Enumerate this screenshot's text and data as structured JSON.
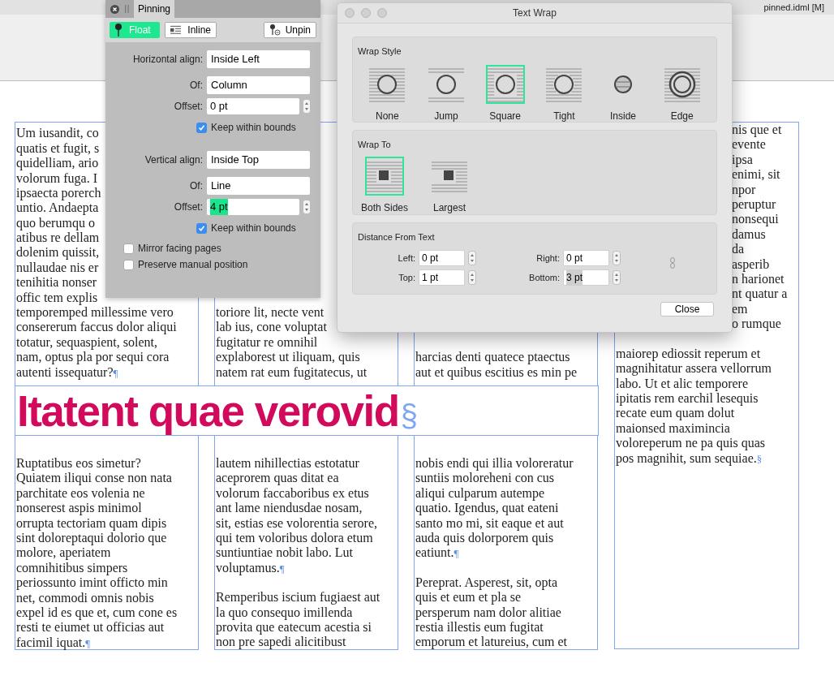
{
  "app": {
    "document_title": "pinned.idml [M]"
  },
  "document": {
    "top_columns": [
      {
        "lines": [
          "Um iusandit, co",
          "quatis et fugit, s",
          "quidelliam, ario",
          "volorum fuga. I",
          "ipsaecta porerch",
          "untio. Andaepta",
          "quo berumqu o",
          "atibus re dellam",
          "dolenim quissit,",
          "nullaudae nis er",
          "tenihitia nonser",
          "offic tem explis",
          "temporemped millessime vero",
          "consererum faccus dolor aliqui",
          "totatur, sequaspient, solent,",
          "nam, optus pla por sequi cora",
          "autenti issequatur?"
        ],
        "end_mark": "¶"
      },
      {
        "lines": [
          "toriore lit, necte vent",
          "lab ius, cone voluptat",
          "fugitatur re omnihil",
          "explaborest ut iliquam, quis",
          "natem rat eum fugitatecus, ut"
        ]
      },
      {
        "lines": [
          "harcias denti quatece ptaectus",
          "aut et quibus escitius es min pe"
        ]
      }
    ],
    "headline": {
      "text": "Itatent quae verovid",
      "end_mark": "§"
    },
    "bottom_columns": [
      {
        "paragraphs": [
          {
            "lines": [
              "Ruptatibus eos simetur?",
              "Quiatem iliqui conse non nata",
              "parchitate eos volenia ne",
              "nonserest aspis minimol",
              "orrupta tectoriam quam dipis",
              "sint doloreptaqui dolorio que",
              "molore, aperiatem",
              "comnihitibus simpers",
              "periossunto imint officto min",
              "net, commodi omnis nobis",
              "expel id es que et, cum cone es",
              "resti te eiumet ut officias aut",
              "facimil iquat."
            ],
            "end_mark": "¶"
          }
        ]
      },
      {
        "paragraphs": [
          {
            "lines": [
              "lautem nihillectias estotatur",
              "aceprorem quas ditat ea",
              "volorum faccaboribus ex etus",
              "ant lame niendusdae nosam,",
              "sit, estias ese volorentia serore,",
              "qui tem voloribus dolora etum",
              "suntiuntiae nobit labo. Lut",
              "voluptamus."
            ],
            "end_mark": "¶"
          },
          {
            "lines": [
              "Remperibus iscium fugiaest aut",
              "la quo consequo imillenda",
              "provita que eatecum acestia si",
              "non pre sapedi alicitibust"
            ]
          }
        ]
      },
      {
        "paragraphs": [
          {
            "lines": [
              "nobis endi qui illia voloreratur",
              "suntiis moloreheni con cus",
              "aliqui culparum autempe",
              "quatio. Igendus, quat eateni",
              "santo mo mi, sit eaque et aut",
              "auda quis dolorporem quis",
              "eatiunt."
            ],
            "end_mark": "¶"
          },
          {
            "lines": [
              "Pereprat. Asperest, sit, opta",
              "quis et eum et pla se",
              "persperum nam dolor alitiae",
              "restia illestis eum fugitat",
              "emporum et latureius, cum et"
            ]
          }
        ]
      }
    ],
    "right_column": {
      "fragments": [
        "nis que et",
        "evente",
        "ipsa",
        "enimi, sit",
        "npor",
        "peruptur",
        "nonsequi",
        "damus",
        "da",
        "asperib",
        "n harionet",
        "nt quatur a",
        "em",
        "o rumque"
      ],
      "lines": [
        "maiorep ediossit reperum et",
        "magnihitatur assera vellorrum",
        "labo. Ut et alic temporere",
        "ipitatis rem earchil lesequis",
        "recate eum quam dolut",
        "maionsed maximincia",
        "voloreperum ne pa quis quas",
        "pos magnihit, sum sequiae."
      ],
      "end_mark": "§"
    }
  },
  "pinning_panel": {
    "tab": "Pinning",
    "modes": [
      {
        "kind": "float",
        "label": "Float",
        "selected": true
      },
      {
        "kind": "inline",
        "label": "Inline",
        "selected": false
      }
    ],
    "unpin_button": "Unpin",
    "groups": [
      {
        "align": {
          "label": "Horizontal align:",
          "value": "Inside Left"
        },
        "of": {
          "label": "Of:",
          "value": "Column"
        },
        "offset": {
          "label": "Offset:",
          "value": "0 pt",
          "text_selected": false
        },
        "keep": {
          "label": "Keep within bounds",
          "checked": true
        }
      },
      {
        "align": {
          "label": "Vertical align:",
          "value": "Inside Top"
        },
        "of": {
          "label": "Of:",
          "value": "Line"
        },
        "offset": {
          "label": "Offset:",
          "value": "4 pt",
          "text_selected": true
        },
        "keep": {
          "label": "Keep within bounds",
          "checked": true
        }
      }
    ],
    "options": [
      {
        "label": "Mirror facing pages",
        "checked": false
      },
      {
        "label": "Preserve manual position",
        "checked": false
      }
    ]
  },
  "text_wrap_dialog": {
    "title": "Text Wrap",
    "wrap_style": {
      "heading": "Wrap Style",
      "options": [
        {
          "kind": "none",
          "label": "None",
          "selected": false
        },
        {
          "kind": "jump",
          "label": "Jump",
          "selected": false
        },
        {
          "kind": "square",
          "label": "Square",
          "selected": true
        },
        {
          "kind": "tight",
          "label": "Tight",
          "selected": false
        },
        {
          "kind": "inside",
          "label": "Inside",
          "selected": false
        },
        {
          "kind": "edge",
          "label": "Edge",
          "selected": false
        }
      ]
    },
    "wrap_to": {
      "heading": "Wrap To",
      "options": [
        {
          "kind": "both",
          "label": "Both Sides",
          "selected": true
        },
        {
          "kind": "largest",
          "label": "Largest",
          "selected": false
        }
      ]
    },
    "distance": {
      "heading": "Distance From Text",
      "fields": [
        {
          "label": "Left:",
          "value": "0 pt",
          "text_selected": false
        },
        {
          "label": "Right:",
          "value": "0 pt",
          "text_selected": false
        },
        {
          "label": "Top:",
          "value": "1 pt",
          "text_selected": false
        },
        {
          "label": "Bottom:",
          "value": "3 pt",
          "text_selected": true
        }
      ]
    },
    "close_button": "Close"
  }
}
